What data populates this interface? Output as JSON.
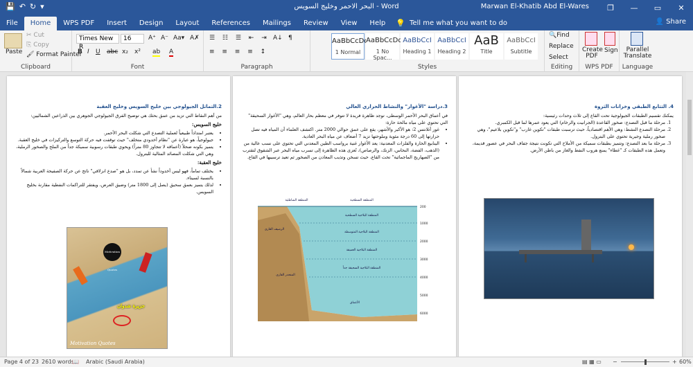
{
  "window": {
    "title": "البحر الاحمر وخليج السويس - Word",
    "user": "Marwan El-Khatib Abd El-Wares",
    "ctl_min": "—",
    "ctl_restore": "❐",
    "ctl_max": "▭",
    "ctl_close": "✕"
  },
  "qat": {
    "save": "💾",
    "undo": "↶",
    "redo": "↻",
    "more": "▾"
  },
  "tabs": [
    "File",
    "Home",
    "WPS PDF",
    "Insert",
    "Design",
    "Layout",
    "References",
    "Mailings",
    "Review",
    "View",
    "Help"
  ],
  "tell_me": "Tell me what you want to do",
  "share": "Share",
  "clipboard": {
    "paste": "Paste",
    "cut": "Cut",
    "copy": "Copy",
    "format_painter": "Format Painter",
    "label": "Clipboard"
  },
  "font": {
    "family": "Times New R",
    "size": "16",
    "label": "Font",
    "bold": "B",
    "italic": "I",
    "underline": "U",
    "strike": "abc",
    "sub": "x₂",
    "sup": "x²",
    "color": "A",
    "highlight": "ab"
  },
  "paragraph": {
    "label": "Paragraph"
  },
  "styles": {
    "label": "Styles",
    "items": [
      {
        "preview": "AaBbCcDd",
        "name": "1 Normal"
      },
      {
        "preview": "AaBbCcDd",
        "name": "1 No Spac..."
      },
      {
        "preview": "AaBbCcI",
        "name": "Heading 1"
      },
      {
        "preview": "AaBbCcI",
        "name": "Heading 2"
      },
      {
        "preview": "AaB",
        "name": "Title"
      },
      {
        "preview": "AaBbCcI",
        "name": "Subtitle"
      }
    ]
  },
  "editing": {
    "find": "Find",
    "replace": "Replace",
    "select": "Select",
    "label": "Editing"
  },
  "wps": {
    "create": "Create PDF",
    "sign": "Sign",
    "label": "WPS PDF"
  },
  "language": {
    "translate": "Parallel Translate",
    "label": "Language"
  },
  "page_left": {
    "heading": "2.التماثل الجيولوجي بين خليج السويس وخليج العقبة",
    "intro": "من أهم النقاط التي تزيد من عمق بحثك هي توضيح الفرق الجيولوجي الجوهري بين الذراعين الشماليين:",
    "suez_title": "خليج السويس:",
    "suez_items": [
      "يعتبر امتداداً طبيعياً لعملية التصدع التي شكلت البحر الأحمر.",
      "جيولوجياً، هو عبارة عن \"نظام أخدودي متخلف\" حيث توقفت فيه حركة التوسع والتركيزات في خليج العقبة.",
      "يتميز بكونه ضحلاً (أعماقه لا تتجاوز 80 متراً) ويحوي طبقات رسوبية سميكة جداً من الملح والصخور الرملية، وهي التي شكلت المصائد المثالية للبترول."
    ],
    "aqaba_title": "خليج العقبة:",
    "aqaba_items": [
      "يختلف تماماً، فهو ليس أخدوداً نشأ عن تمدد، بل هو \"صدع انزلاقي\" ناتج عن حركة الصفيحة العربية شمالاً بالنسبة لسيناء.",
      "لذلك يتميز بعمق سحيق (يصل إلى 1800 متر) وضيق العرض، ويفتقر للتراكمات النفطية مقارنة بخليج السويس."
    ],
    "map_label_island": "جزيرة شدوان",
    "map_label_badge": "Motivation Quotes",
    "map_watermark": "Motivation Quotes"
  },
  "page_mid": {
    "heading": "3.دراسة \"الأغوار\" والنشاط الحراري العالي",
    "intro": "في أعماق البحر الأحمر الوسطى، توجد ظاهرة فريدة لا تتوفر في معظم بحار العالم، وهي \"الأغوار السحيقة\" التي تحتوي على مياه مالحة حارة:",
    "items": [
      "غور أتلانتس 2: هو الأكبر والأشهر، يقع على عمق حوالي 2000 متر. اكتشف العلماء أن المياه فيه تصل حرارتها إلى 60 درجة مئوية وملوحتها تزيد 7 أضعاف عن مياه البحر العادية.",
      "الينابيع الحارة والفلزات المعدنية: يعد الأغوار غنية برواسب الطين المعدني التي تحتوي على نسب عالية من (الذهب، الفضة، النحاس، الزنك، والرصاص)، تُعزى هذه الظاهرة إلى تسرب مياه البحر عبر الشقوق لتقترب من \"الصهاريج الماجمائية\" تحت القاع، حيث تسخن وتذيب المعادن من الصخور ثم تعيد ترسيبها في القاع."
    ],
    "diagram": {
      "zones": [
        "المنطقة الشاطئية",
        "المنطقة السطحية",
        "المنطقة البلاجية السطحية",
        "المنطقة البلاجية المتوسطة",
        "المنطقة البلاجية العميقة",
        "المنطقة البلاجية السحيقة جداً",
        "الأعماق"
      ],
      "shelf": "الرصيف القاري",
      "slope": "المنحدر القاري",
      "depths": [
        "200",
        "1000",
        "2000",
        "3000",
        "4000",
        "5000",
        "6000"
      ]
    }
  },
  "page_right": {
    "heading": "4. التتابع الطبقي وخزانات الثروة",
    "intro": "يمكنك تقسيم الطبقات الجيولوجية تحت القاع إلى ثلاث وحدات رئيسية:",
    "items": [
      "مرحلة ما قبل التصدع: صخور القاعدة (الجرانيت والرخام) التي يعود عمرها لما قبل الكمبري.",
      "مرحلة التصدع النشط: وهي الأهم اقتصادياً، حيث ترسبت طبقات \"تكوين غارب\" و\"تكوين بلاعيم\"، وهي صخور رملية وجيرية تحتوي على البترول.",
      "مرحلة ما بعد التصدع: وتتميز بطبقات سميكة من الأملاح التي تكونت نتيجة جفاف البحر في عصور قديمة، وتعمل هذه الطبقات كـ \"غطاء\" يمنع هروب النفط والغاز من باطن الأرض."
    ]
  },
  "status": {
    "page": "Page 4 of 23",
    "words": "2610 words",
    "language": "Arabic (Saudi Arabia)",
    "zoom": "60%"
  }
}
